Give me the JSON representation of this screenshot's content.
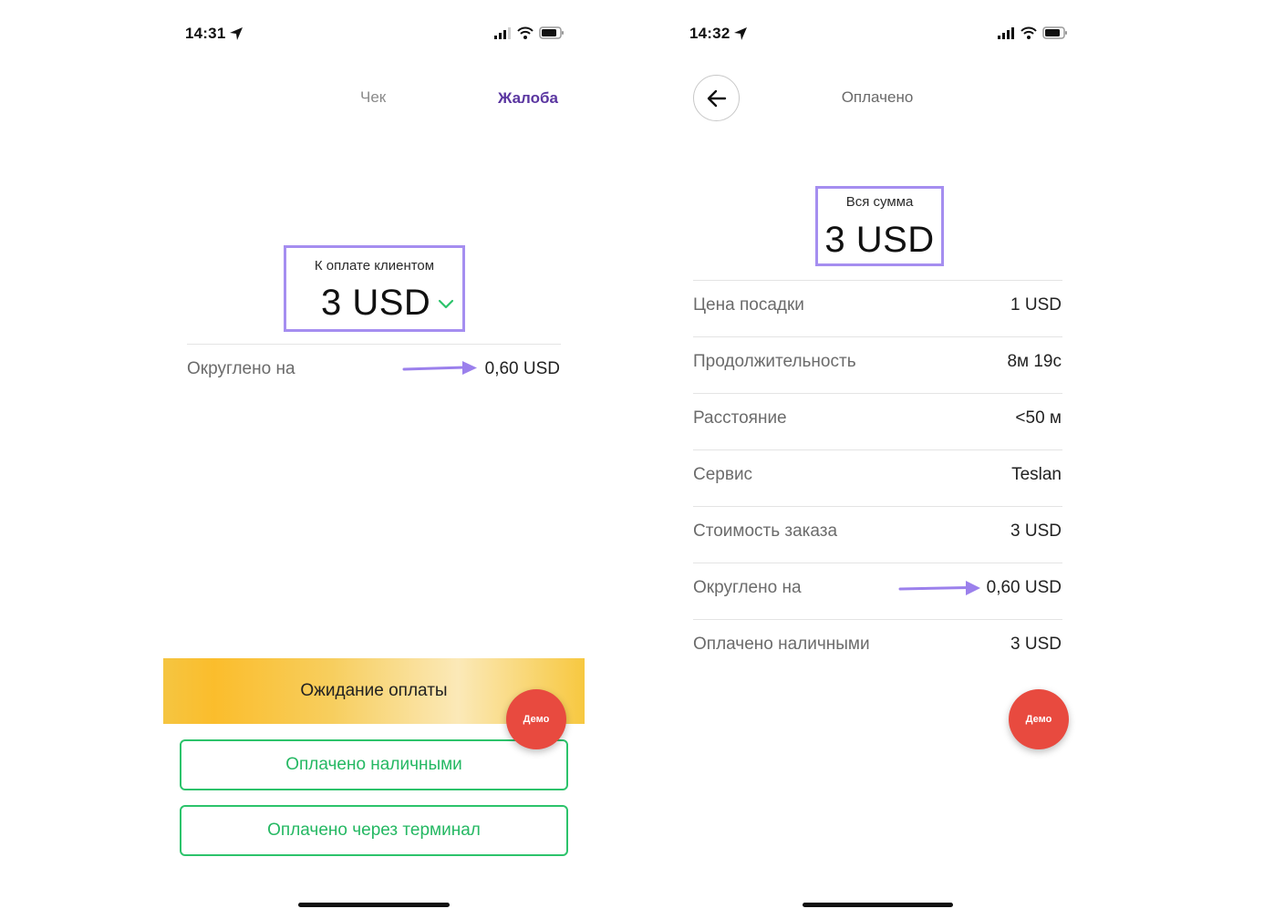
{
  "left": {
    "status": {
      "time": "14:31"
    },
    "tabs": {
      "check": "Чек",
      "complaint": "Жалоба"
    },
    "amount": {
      "label": "К оплате клиентом",
      "value": "3 USD"
    },
    "rounded": {
      "label": "Округлено на",
      "value": "0,60 USD"
    },
    "waiting": "Ожидание оплаты",
    "demo": "Демо",
    "buttons": {
      "cash": "Оплачено наличными",
      "terminal": "Оплачено через терминал"
    }
  },
  "right": {
    "status": {
      "time": "14:32"
    },
    "title": "Оплачено",
    "total": {
      "label": "Вся сумма",
      "value": "3 USD"
    },
    "rows": [
      {
        "label": "Цена посадки",
        "value": "1 USD"
      },
      {
        "label": "Продолжительность",
        "value": "8м 19с"
      },
      {
        "label": "Расстояние",
        "value": "<50 м"
      },
      {
        "label": "Сервис",
        "value": "Teslan"
      },
      {
        "label": "Стоимость заказа",
        "value": "3 USD"
      },
      {
        "label": "Округлено на",
        "value": "0,60 USD"
      },
      {
        "label": "Оплачено наличными",
        "value": "3 USD"
      }
    ],
    "demo": "Демо"
  },
  "colors": {
    "accent_purple": "#5a35a0",
    "highlight": "#a58ef0",
    "green": "#2cc36b",
    "demo_red": "#e84a3f",
    "banner_yellow": "#f7c840"
  }
}
